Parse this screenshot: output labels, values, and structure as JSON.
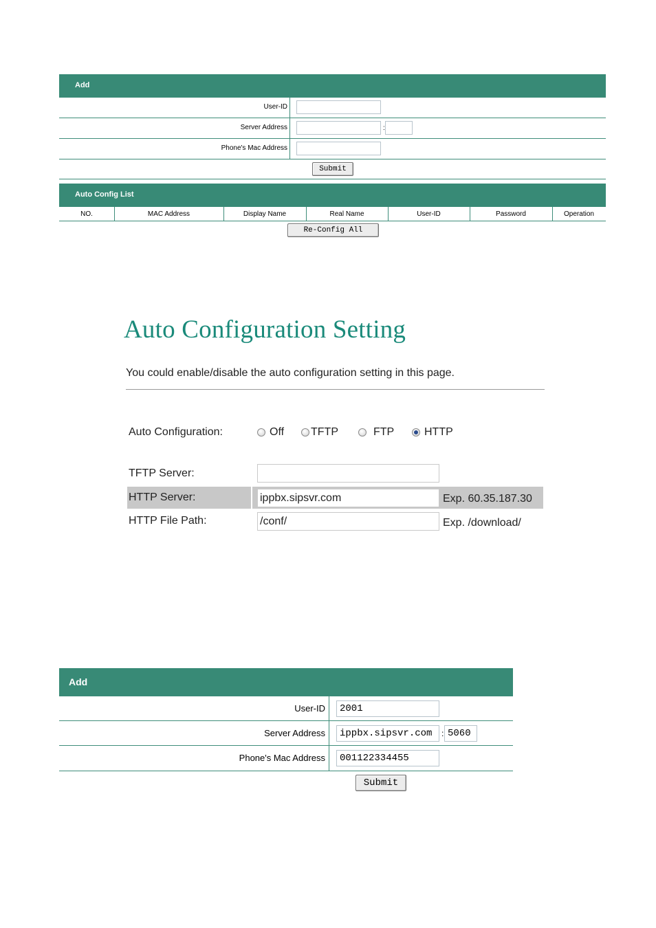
{
  "top_form": {
    "header": "Add",
    "fields": {
      "user_id_label": "User-ID",
      "server_address_label": "Server Address",
      "mac_label": "Phone's Mac Address",
      "colon": ":"
    },
    "values": {
      "user_id": "",
      "server_address": "",
      "port": "",
      "mac": ""
    },
    "submit_label": "Submit"
  },
  "auto_config_list": {
    "header": "Auto Config List",
    "columns": [
      "NO.",
      "MAC Address",
      "Display Name",
      "Real Name",
      "User-ID",
      "Password",
      "Operation"
    ],
    "reconfig_label": "Re-Config All"
  },
  "auto_configuration": {
    "title": "Auto Configuration Setting",
    "description": "You could enable/disable the auto configuration setting in this page.",
    "mode_label": "Auto Configuration:",
    "options": [
      "Off",
      "TFTP",
      "FTP",
      "HTTP"
    ],
    "selected": "HTTP",
    "tftp_server_label": "TFTP Server:",
    "tftp_server_value": "",
    "http_server_label": "HTTP Server:",
    "http_server_value": "ippbx.sipsvr.com",
    "http_server_example": "Exp. 60.35.187.30",
    "http_file_path_label": "HTTP File Path:",
    "http_file_path_value": "/conf/",
    "http_file_path_example": "Exp. /download/"
  },
  "bottom_form": {
    "header": "Add",
    "fields": {
      "user_id_label": "User-ID",
      "server_address_label": "Server Address",
      "mac_label": "Phone's Mac Address",
      "colon": ":"
    },
    "values": {
      "user_id": "2001",
      "server_address": "ippbx.sipsvr.com",
      "port": "5060",
      "mac": "001122334455"
    },
    "submit_label": "Submit"
  }
}
